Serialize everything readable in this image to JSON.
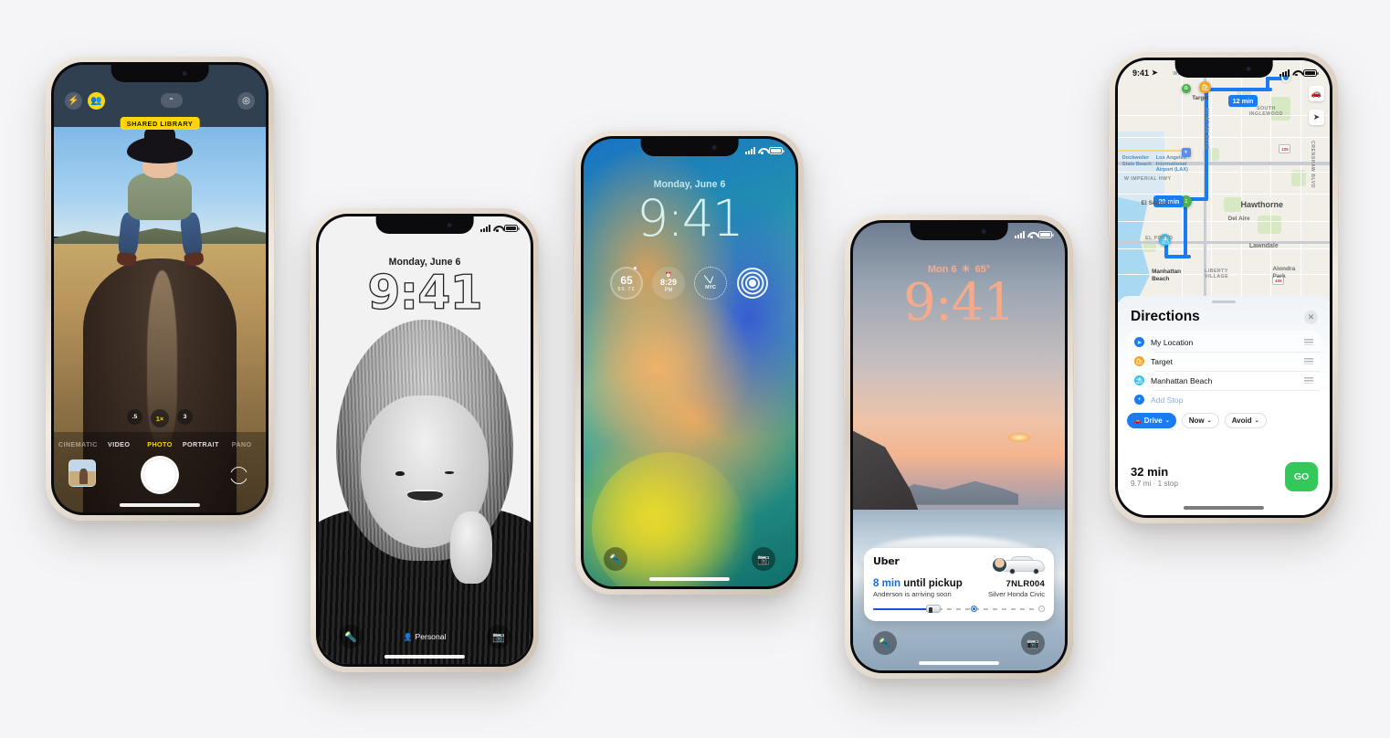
{
  "scene": {
    "background": "#f5f5f7",
    "device_count": 5
  },
  "phone1_camera": {
    "name": "Camera",
    "top_controls": {
      "flash_icon": "bolt-icon",
      "shared_library_icon": "people-icon",
      "expand_icon": "chevron-up-icon",
      "live_photo_icon": "live-photo-icon"
    },
    "badge": "SHARED LIBRARY",
    "zoom_levels": [
      ".5",
      "1×",
      "3"
    ],
    "zoom_active": "1×",
    "modes": [
      "CINEMATIC",
      "VIDEO",
      "PHOTO",
      "PORTRAIT",
      "PANO"
    ],
    "mode_active": "PHOTO",
    "shutter_label": "shutter-button",
    "thumbnail_label": "last-photo-thumbnail",
    "flip_label": "flip-camera-button",
    "accent": "#ffd60a"
  },
  "phone2_lockscreen_bw": {
    "status": {
      "signal": "signal-bars-icon",
      "wifi": "wifi-icon",
      "battery": "battery-icon"
    },
    "date": "Monday, June 6",
    "time": "9:41",
    "focus_label": "Personal",
    "flashlight_icon": "flashlight-icon",
    "camera_icon": "camera-icon",
    "clock_style": "outline"
  },
  "phone3_lockscreen_widgets": {
    "status": {
      "signal": "signal-bars-icon",
      "wifi": "wifi-icon",
      "battery": "battery-icon"
    },
    "date": "Monday, June 6",
    "time": "9:41",
    "time_color": "#d9f2ee",
    "widgets": [
      {
        "type": "weather-temperature",
        "value": "65",
        "low": "55",
        "high": "72"
      },
      {
        "type": "alarm",
        "icon": "alarm-icon",
        "value": "8:29",
        "period": "PM"
      },
      {
        "type": "world-clock",
        "label": "NYC"
      },
      {
        "type": "activity-rings",
        "label": "fitness-rings"
      }
    ],
    "flashlight_icon": "flashlight-icon",
    "camera_icon": "camera-icon"
  },
  "phone4_live_activity": {
    "status": {
      "signal": "signal-bars-icon",
      "wifi": "wifi-icon",
      "battery": "battery-icon"
    },
    "date": "Mon 6",
    "weather_icon": "sun-icon",
    "temperature": "65°",
    "time": "9:41",
    "time_color": "#f6aa89",
    "uber": {
      "app_name": "Uber",
      "eta_value": "8 min",
      "eta_suffix": " until pickup",
      "driver_status": "Anderson is arriving soon",
      "plate": "7NLR004",
      "vehicle": "Silver Honda Civic",
      "eta_color": "#1c6ae0",
      "progress_percent": 33
    },
    "flashlight_icon": "flashlight-icon",
    "camera_icon": "camera-icon"
  },
  "phone5_maps": {
    "status": {
      "time": "9:41",
      "location_icon": "location-arrow-icon",
      "signal": "signal-bars-icon",
      "wifi": "wifi-icon",
      "battery": "battery-icon"
    },
    "map": {
      "labels": [
        "WESTCHESTER",
        "Target",
        "SOUTH INGLEWOOD",
        "Dockweiler State Beach",
        "Los Angeles International Airport (LAX)",
        "W IMPERIAL HWY",
        "AVIATION BLVD",
        "El Segundo",
        "Hawthorne",
        "Del Aire",
        "EL PORTO",
        "Lawndale",
        "LIBERTY VILLAGE",
        "Alondra Park",
        "CRENSHAW BLVD",
        "Manhattan Beach"
      ],
      "route_etas": [
        "12 min",
        "20 min"
      ],
      "highway_shields": [
        "105",
        "405"
      ],
      "route_marker": "1",
      "controls": [
        "car-icon",
        "location-arrow-icon"
      ],
      "route_color": "#1a7cf0"
    },
    "sheet": {
      "title": "Directions",
      "close_icon": "close-icon",
      "stops": [
        {
          "label": "My Location",
          "icon": "location-arrow-icon",
          "color": "#1a7cf0"
        },
        {
          "label": "Target",
          "icon": "shopping-bag-icon",
          "color": "#f5a623"
        },
        {
          "label": "Manhattan Beach",
          "icon": "beach-umbrella-icon",
          "color": "#35c3f3"
        }
      ],
      "add_stop_label": "Add Stop",
      "add_stop_icon": "plus-icon",
      "options": [
        {
          "label": "Drive",
          "icon": "car-icon",
          "chevron": "chevron-down-icon",
          "active": true
        },
        {
          "label": "Now",
          "chevron": "chevron-down-icon",
          "active": false
        },
        {
          "label": "Avoid",
          "chevron": "chevron-down-icon",
          "active": false
        }
      ],
      "total_time": "32 min",
      "total_sub": "9.7 mi · 1 stop",
      "go_label": "GO",
      "go_color": "#34c759"
    }
  }
}
